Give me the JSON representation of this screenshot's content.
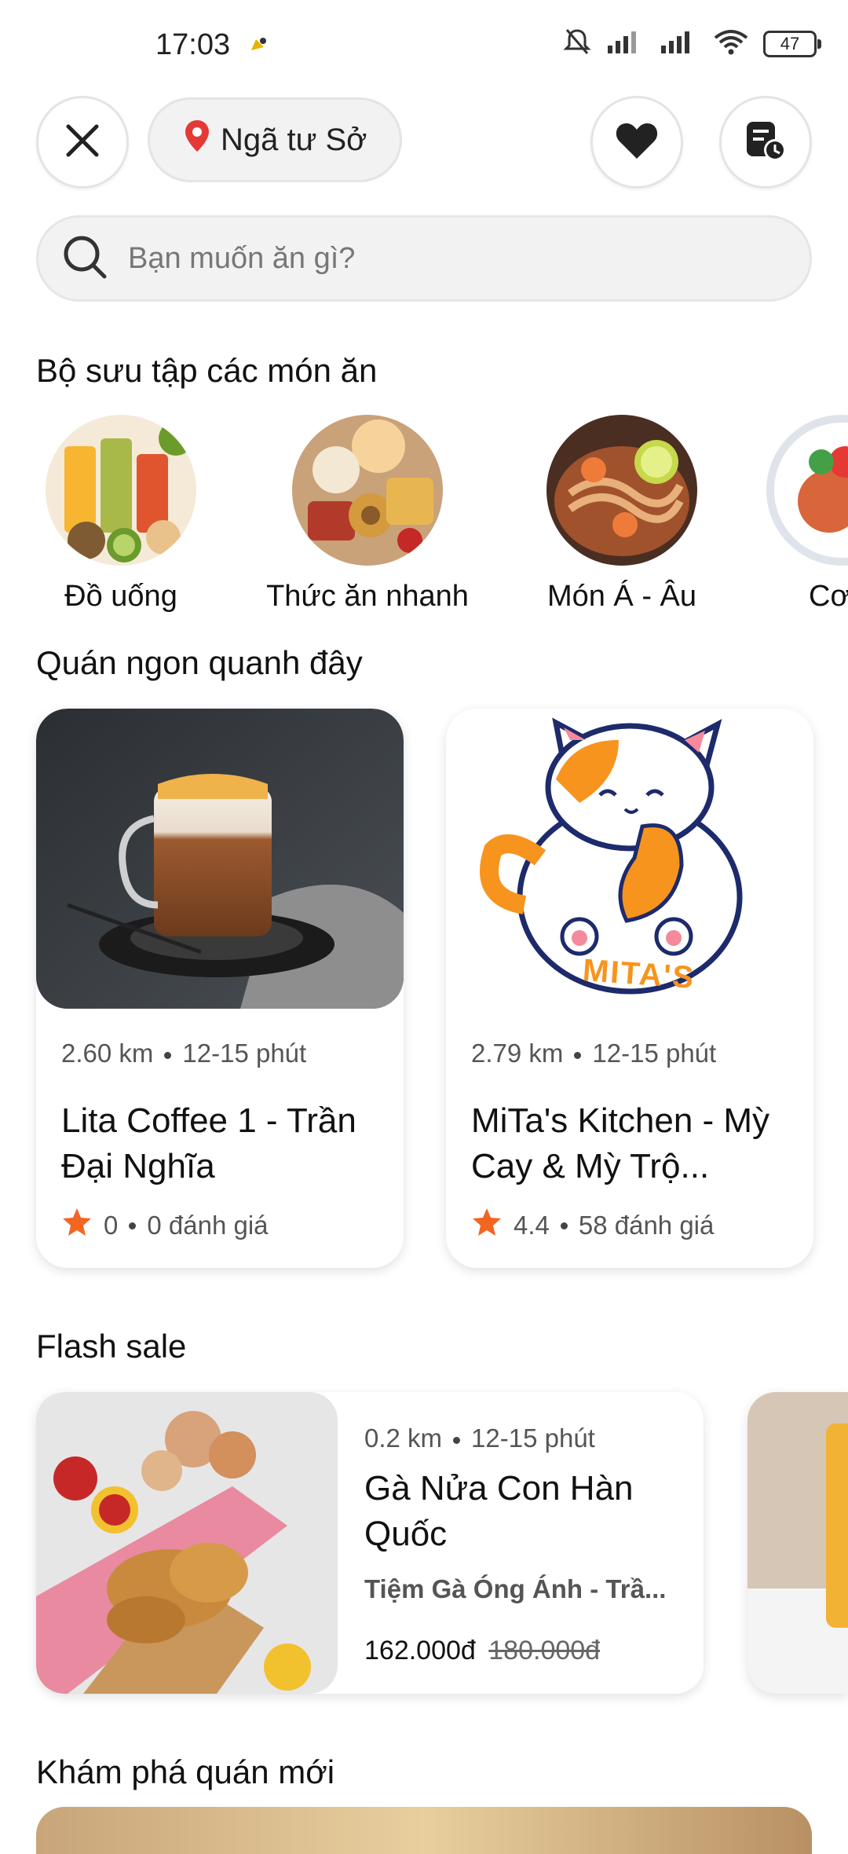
{
  "status": {
    "time": "17:03",
    "battery": "47"
  },
  "header": {
    "location": "Ngã tư Sở"
  },
  "search": {
    "placeholder": "Bạn muốn ăn gì?"
  },
  "collections": {
    "title": "Bộ sưu tập các món ăn",
    "items": [
      {
        "label": "Đồ uống"
      },
      {
        "label": "Thức ăn nhanh"
      },
      {
        "label": "Món Á - Âu"
      },
      {
        "label": "Cơ"
      }
    ]
  },
  "nearby": {
    "title": "Quán ngon quanh đây",
    "shops": [
      {
        "distance": "2.60 km",
        "time": "12-15 phút",
        "name": "Lita Coffee 1 - Trần Đại Nghĩa",
        "rating": "0",
        "reviews": "0 đánh giá"
      },
      {
        "distance": "2.79 km",
        "time": "12-15 phút",
        "name": "MiTa's Kitchen - Mỳ Cay & Mỳ Trộ...",
        "rating": "4.4",
        "reviews": "58 đánh giá",
        "logo_text": "MITA'S"
      }
    ]
  },
  "flash_sale": {
    "title": "Flash sale",
    "item": {
      "distance": "0.2 km",
      "time": "12-15 phút",
      "name": "Gà Nửa Con Hàn Quốc",
      "shop": "Tiệm Gà Óng Ánh - Trầ...",
      "price": "162.000đ",
      "old_price": "180.000đ"
    }
  },
  "discover": {
    "title": "Khám phá quán mới"
  },
  "colors": {
    "accent": "#f26522",
    "pin": "#e53935"
  }
}
